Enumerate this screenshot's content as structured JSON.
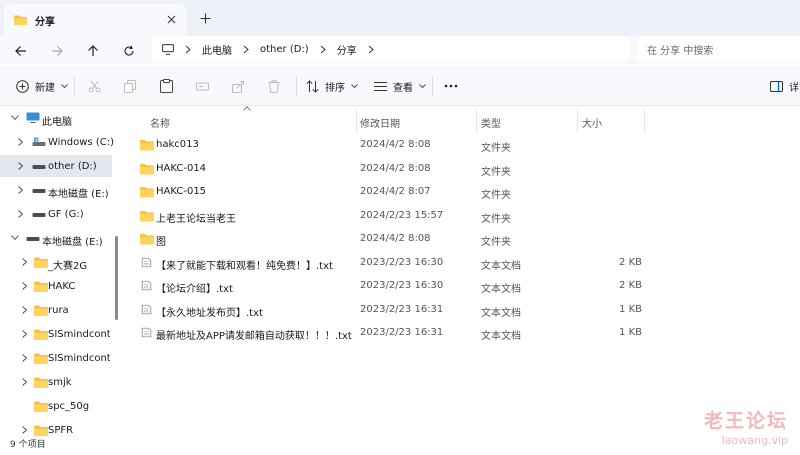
{
  "tab": {
    "title": "分享"
  },
  "address": {
    "crumbs": [
      "此电脑",
      "other (D:)",
      "分享"
    ],
    "search_placeholder": "在 分享 中搜索"
  },
  "toolbar": {
    "new_label": "新建",
    "sort_label": "排序",
    "view_label": "查看",
    "details_label": "详"
  },
  "sidebar": {
    "items": [
      {
        "label": "此电脑",
        "icon": "pc-icon"
      },
      {
        "label": "Windows (C:)",
        "icon": "windows-drive-icon"
      },
      {
        "label": "other (D:)",
        "icon": "drive-icon"
      },
      {
        "label": "本地磁盘 (E:)",
        "icon": "drive-icon"
      },
      {
        "label": "GF (G:)",
        "icon": "drive-icon"
      },
      {
        "label": "本地磁盘 (E:)",
        "icon": "drive-icon"
      },
      {
        "label": "_大赛2G",
        "icon": "folder-icon"
      },
      {
        "label": "HAKC",
        "icon": "folder-icon"
      },
      {
        "label": "rura",
        "icon": "folder-icon"
      },
      {
        "label": "SISmindcontro",
        "icon": "folder-icon"
      },
      {
        "label": "SISmindcontro",
        "icon": "folder-icon"
      },
      {
        "label": "smjk",
        "icon": "folder-icon"
      },
      {
        "label": "spc_50g",
        "icon": "folder-icon"
      },
      {
        "label": "SPFR",
        "icon": "folder-icon"
      }
    ]
  },
  "columns": {
    "name": "名称",
    "modified": "修改日期",
    "type": "类型",
    "size": "大小"
  },
  "files": [
    {
      "name": "hakc013",
      "date": "2024/4/2 8:08",
      "type": "文件夹",
      "size": "",
      "icon": "folder-icon"
    },
    {
      "name": "HAKC-014",
      "date": "2024/4/2 8:08",
      "type": "文件夹",
      "size": "",
      "icon": "folder-icon"
    },
    {
      "name": "HAKC-015",
      "date": "2024/4/2 8:07",
      "type": "文件夹",
      "size": "",
      "icon": "folder-icon"
    },
    {
      "name": "上老王论坛当老王",
      "date": "2024/2/23 15:57",
      "type": "文件夹",
      "size": "",
      "icon": "folder-icon"
    },
    {
      "name": "图",
      "date": "2024/4/2 8:08",
      "type": "文件夹",
      "size": "",
      "icon": "folder-icon"
    },
    {
      "name": "【来了就能下载和观看！纯免费！】.txt",
      "date": "2023/2/23 16:30",
      "type": "文本文档",
      "size": "2 KB",
      "icon": "text-file-icon"
    },
    {
      "name": "【论坛介绍】.txt",
      "date": "2023/2/23 16:30",
      "type": "文本文档",
      "size": "2 KB",
      "icon": "text-file-icon"
    },
    {
      "name": "【永久地址发布页】.txt",
      "date": "2023/2/23 16:31",
      "type": "文本文档",
      "size": "1 KB",
      "icon": "text-file-icon"
    },
    {
      "name": "最新地址及APP请发邮箱自动获取！！！.txt",
      "date": "2023/2/23 16:31",
      "type": "文本文档",
      "size": "1 KB",
      "icon": "text-file-icon"
    }
  ],
  "status": {
    "item_count": "9 个项目"
  },
  "watermark": {
    "title": "老王论坛",
    "url": "laowang.vip"
  },
  "colors": {
    "folder": "#f5c342",
    "accent": "#0067c0",
    "selected": "#e3e7ee",
    "watermark": "#f2b8b8"
  }
}
